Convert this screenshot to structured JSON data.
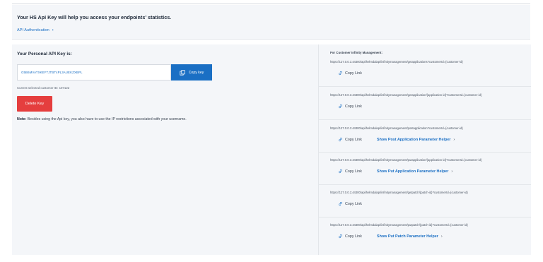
{
  "header": {
    "title": "Your HS Api Key will help you access your endpoints' statistics.",
    "api_auth_link": "API Authentication",
    "chevron": "›"
  },
  "left": {
    "key_label": "Your Personal API Key is:",
    "api_key": "G5B6MVATXKEFTJTBT4PL3AUEKZXBPL",
    "copy_key_label": "Copy key",
    "customer_id_label": "Current selected customer ID:",
    "customer_id": "107122",
    "delete_key_label": "Delete Key",
    "note_label": "Note:",
    "note_text": "Besides using the Api key, you also have to use the IP restrictions associated with your username."
  },
  "right": {
    "title": "For Customer Infinity Management:",
    "copy_link_label": "Copy Link",
    "endpoints": [
      {
        "url": "https://127.0.0.1:44300/api/helmdalapi/infinitymanagement/getapplications?customerId={customer-id}",
        "helper": ""
      },
      {
        "url": "https://127.0.0.1:44300/api/helmdalapi/infinitymanagement/getapplication/{application-id}?customerId={customer-id}",
        "helper": ""
      },
      {
        "url": "https://127.0.0.1:44300/api/helmdalapi/infinitymanagement/postapplication?customerId={customer-id}",
        "helper": "Show Post Application Parameter Helper"
      },
      {
        "url": "https://127.0.0.1:44300/api/helmdalapi/infinitymanagement/putapplication/{application-id}?customerId={customer-id}",
        "helper": "Show Put Application Parameter Helper"
      },
      {
        "url": "https://127.0.0.1:44300/api/helmdalapi/infinitymanagement/getpatch/{patch-id}?customerId={customer-id}",
        "helper": ""
      },
      {
        "url": "https://127.0.0.1:44300/api/helmdalapi/infinitymanagement/putpatch/{patch-id}?customerId={customer-id}",
        "helper": "Show Put Patch Parameter Helper"
      }
    ]
  },
  "icons": {
    "copy": "copy-icon",
    "link": "link-icon",
    "chevron": "chevron-right-icon"
  },
  "colors": {
    "accent": "#1a6fc4",
    "danger": "#e53e3e",
    "panel": "#f4f6f9"
  }
}
